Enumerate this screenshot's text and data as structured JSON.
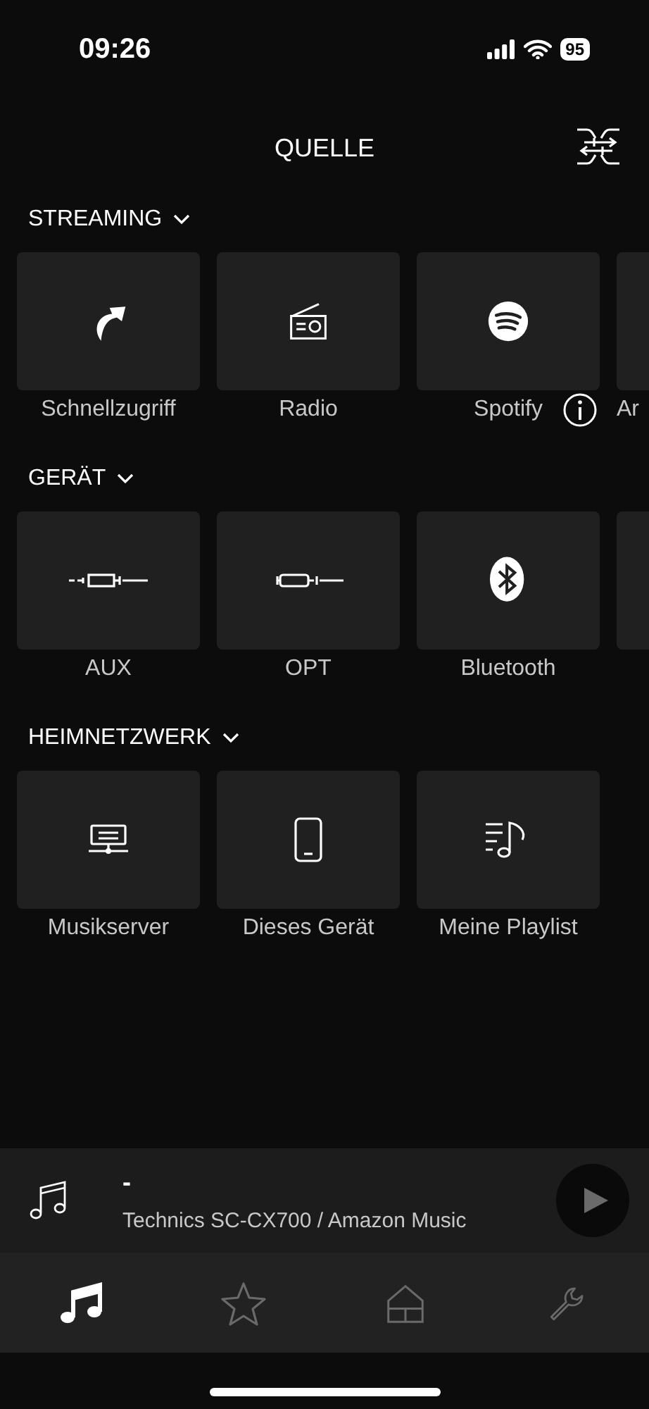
{
  "status_bar": {
    "time": "09:26",
    "battery": "95"
  },
  "header": {
    "title": "QUELLE"
  },
  "sections": [
    {
      "title": "STREAMING",
      "expanded": true,
      "tiles": [
        {
          "kind": "shortcut",
          "label": "Schnellzugriff"
        },
        {
          "kind": "radio",
          "label": "Radio"
        },
        {
          "kind": "spotify",
          "label": "Spotify",
          "info": true
        },
        {
          "kind": "blank",
          "label": "Ar"
        }
      ]
    },
    {
      "title": "GERÄT",
      "expanded": true,
      "tiles": [
        {
          "kind": "aux",
          "label": "AUX"
        },
        {
          "kind": "opt",
          "label": "OPT"
        },
        {
          "kind": "bluetooth",
          "label": "Bluetooth"
        },
        {
          "kind": "blank"
        }
      ]
    },
    {
      "title": "HEIMNETZWERK",
      "expanded": true,
      "tiles": [
        {
          "kind": "server",
          "label": "Musikserver"
        },
        {
          "kind": "phone",
          "label": "Dieses Gerät"
        },
        {
          "kind": "playlist",
          "label": "Meine Playlist"
        }
      ]
    }
  ],
  "player": {
    "title": "-",
    "subtitle": "Technics SC-CX700 / Amazon Music"
  },
  "tabs": [
    {
      "kind": "music",
      "selected": true
    },
    {
      "kind": "star",
      "selected": false
    },
    {
      "kind": "home",
      "selected": false
    },
    {
      "kind": "wrench",
      "selected": false
    }
  ]
}
